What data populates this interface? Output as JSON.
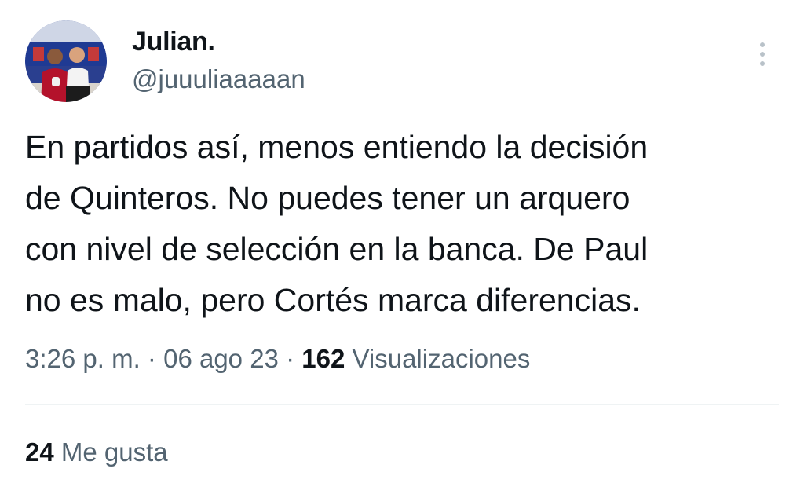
{
  "author": {
    "display_name": "Julian.",
    "handle": "@juuuliaaaaan"
  },
  "tweet": {
    "text_lines": [
      "En partidos así, menos entiendo la decisión",
      "de Quinteros. No puedes tener un arquero",
      "con nivel de selección en la banca. De Paul",
      "no es malo, pero Cortés marca diferencias."
    ],
    "time": "3:26 p. m.",
    "separator": "·",
    "date": "06 ago 23",
    "views_count": "162",
    "views_label": "Visualizaciones"
  },
  "stats": {
    "likes_count": "24",
    "likes_label": "Me gusta"
  },
  "icons": {
    "more": "more-vertical-icon"
  },
  "colors": {
    "text_primary": "#0f1419",
    "text_secondary": "#536471",
    "divider": "#eff3f4"
  }
}
